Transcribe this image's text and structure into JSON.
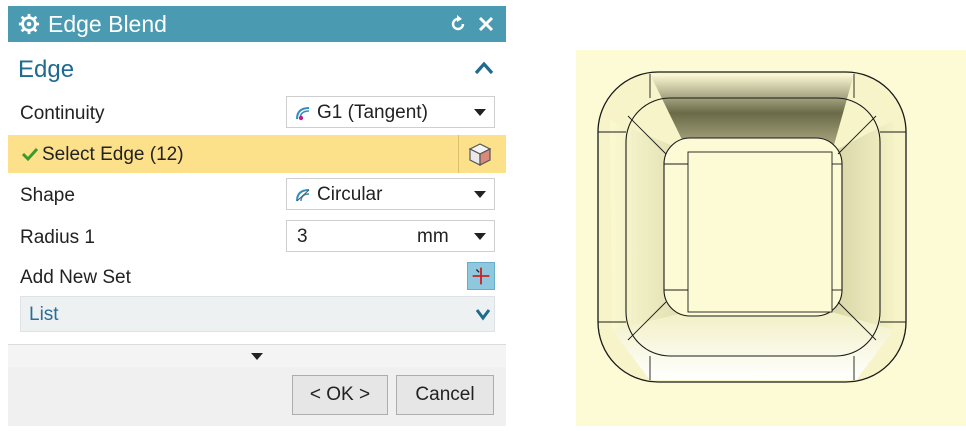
{
  "dialog": {
    "title": "Edge Blend",
    "icons": {
      "settings": "gear-icon",
      "reset": "reset-icon",
      "close": "close-icon"
    }
  },
  "edge_section": {
    "label": "Edge",
    "collapse_icon": "chevron-up-icon",
    "continuity": {
      "label": "Continuity",
      "value": "G1 (Tangent)",
      "icon": "tangent-continuity-icon"
    },
    "select_edge": {
      "label": "Select Edge (12)",
      "status_icon": "checkmark-icon",
      "selector_icon": "cube-select-icon"
    },
    "shape": {
      "label": "Shape",
      "value": "Circular",
      "icon": "circular-shape-icon"
    },
    "radius": {
      "label": "Radius 1",
      "value": "3",
      "unit": "mm"
    },
    "add_new_set": {
      "label": "Add New Set",
      "icon": "add-set-icon"
    },
    "list": {
      "label": "List",
      "expand_icon": "chevron-down-icon"
    }
  },
  "footer": {
    "ok_label": "< OK >",
    "cancel_label": "Cancel"
  },
  "colors": {
    "titlebar": "#4a9bb1",
    "selected_row": "#fce08a",
    "accent_text": "#1f6b8f",
    "viewport_bg": "#fdfbd6"
  }
}
